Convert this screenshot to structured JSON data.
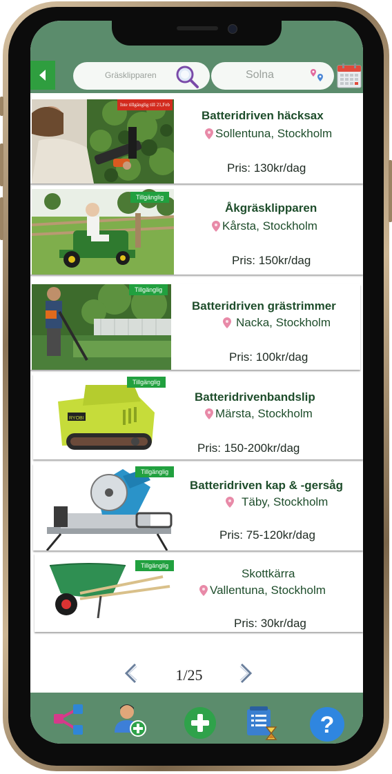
{
  "header": {
    "search": {
      "value": "Gräsklipparen"
    },
    "location": {
      "value": "Solna"
    }
  },
  "listings": [
    {
      "title": "Batteridriven  häcksax",
      "location": "Sollentuna, Stockholm",
      "price": "Pris: 130kr/dag",
      "badge": "Inte tillgänglig till 21,Feb",
      "badge_color": "#d22b1e"
    },
    {
      "title": "Åkgräsklipparen",
      "location": "Kårsta, Stockholm",
      "price": "Pris: 150kr/dag",
      "badge": "Tillgänglig",
      "badge_color": "#21a03f"
    },
    {
      "title": "Batteridriven grästrimmer",
      "location": "Nacka, Stockholm",
      "price": "Pris: 100kr/dag",
      "badge": "Tillgänglig",
      "badge_color": "#21a03f"
    },
    {
      "title": "Batteridrivenbandslip",
      "location": "Märsta, Stockholm",
      "price": "Pris: 150-200kr/dag",
      "badge": "Tillgänglig",
      "badge_color": "#21a03f"
    },
    {
      "title": "Batteridriven kap & -gersåg",
      "location": "Täby, Stockholm",
      "price": "Pris: 75-120kr/dag",
      "badge": "Tillgänglig",
      "badge_color": "#21a03f"
    },
    {
      "title": "Skottkärra",
      "location": "Vallentuna, Stockholm",
      "price": "Pris: 30kr/dag",
      "badge": "Tillgänglig",
      "badge_color": "#21a03f"
    }
  ],
  "pagination": {
    "label": "1/25"
  },
  "icons": {
    "back": "arrow-left-icon",
    "search": "magnifier-icon",
    "location": "map-pins-icon",
    "calendar": "calendar-icon",
    "share": "share-icon",
    "add_user": "add-user-icon",
    "add": "plus-icon",
    "history": "list-hourglass-icon",
    "help": "question-icon"
  },
  "colors": {
    "bar": "#5b8c6c",
    "accent": "#2f9e3f",
    "title": "#1e4d2b",
    "available": "#21a03f",
    "unavailable": "#d22b1e"
  }
}
